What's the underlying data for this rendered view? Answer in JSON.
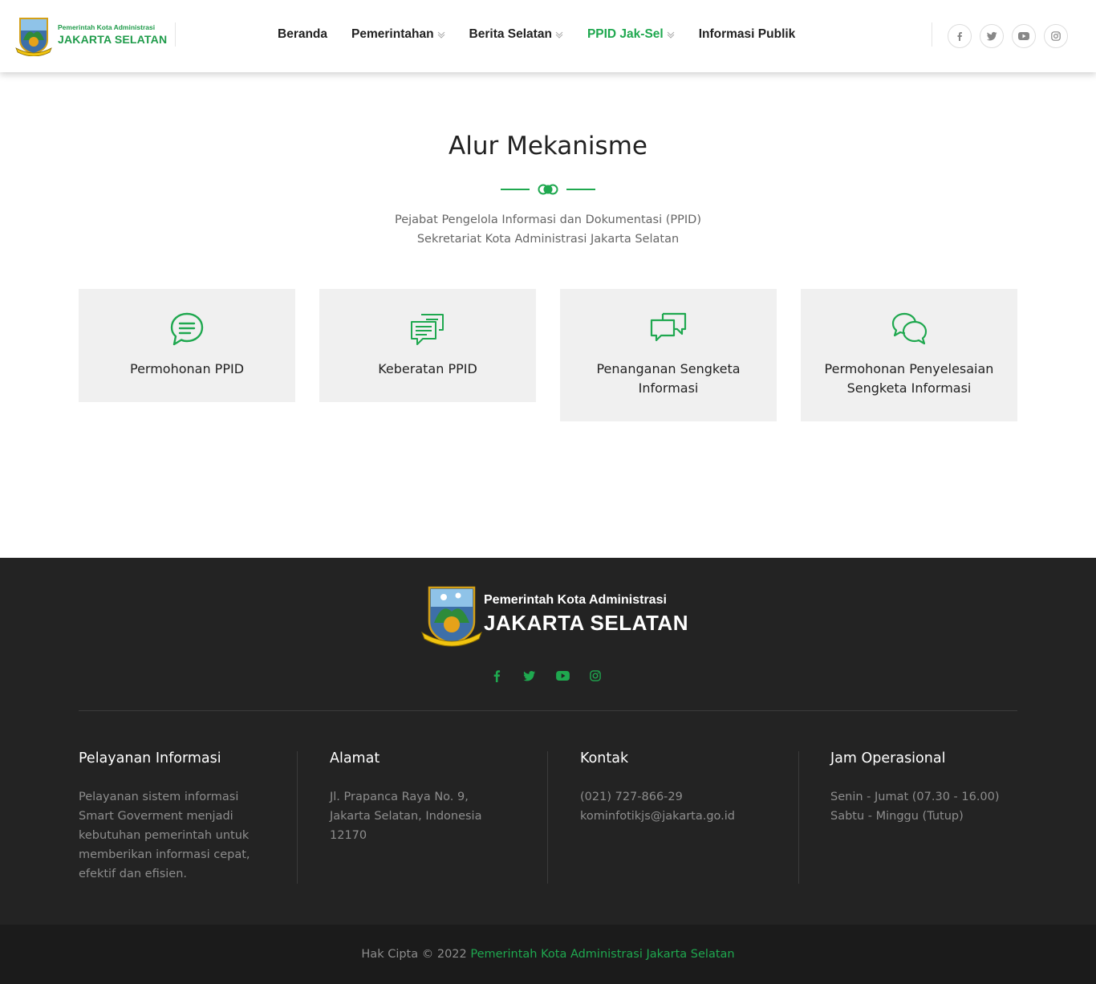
{
  "header": {
    "logo": {
      "line1": "Pemerintah Kota Administrasi",
      "line2": "JAKARTA SELATAN"
    },
    "nav": [
      {
        "label": "Beranda",
        "dropdown": false,
        "active": false
      },
      {
        "label": "Pemerintahan",
        "dropdown": true,
        "active": false
      },
      {
        "label": "Berita Selatan",
        "dropdown": true,
        "active": false
      },
      {
        "label": "PPID Jak-Sel",
        "dropdown": true,
        "active": true
      },
      {
        "label": "Informasi Publik",
        "dropdown": false,
        "active": false
      }
    ],
    "social_icons": [
      "facebook-icon",
      "twitter-icon",
      "youtube-icon",
      "instagram-icon"
    ]
  },
  "main": {
    "title": "Alur Mekanisme",
    "subtitle_line1": "Pejabat Pengelola Informasi dan Dokumentasi (PPID)",
    "subtitle_line2": "Sekretariat Kota Administrasi Jakarta Selatan",
    "cards": [
      {
        "icon": "chat-bubble-icon",
        "label": "Permohonan PPID"
      },
      {
        "icon": "messages-icon",
        "label": "Keberatan PPID"
      },
      {
        "icon": "conversation-icon",
        "label": "Penanganan Sengketa Informasi"
      },
      {
        "icon": "discussion-icon",
        "label": "Permohonan Penyelesaian Sengketa Informasi"
      }
    ]
  },
  "footer": {
    "logo": {
      "line1": "Pemerintah Kota Administrasi",
      "line2": "JAKARTA SELATAN"
    },
    "social_icons": [
      "facebook-icon",
      "twitter-icon",
      "youtube-icon",
      "instagram-icon"
    ],
    "columns": [
      {
        "title": "Pelayanan Informasi",
        "lines": [
          "Pelayanan sistem informasi",
          "Smart Goverment menjadi",
          "kebutuhan pemerintah untuk",
          "memberikan informasi cepat,",
          "efektif dan efisien."
        ]
      },
      {
        "title": "Alamat",
        "lines": [
          "Jl. Prapanca Raya No. 9,",
          "Jakarta Selatan, Indonesia",
          "12170"
        ]
      },
      {
        "title": "Kontak",
        "lines": [
          "(021) 727-866-29",
          "kominfotikjs@jakarta.go.id"
        ]
      },
      {
        "title": "Jam Operasional",
        "lines": [
          "Senin - Jumat (07.30 - 16.00)",
          "Sabtu - Minggu (Tutup)"
        ]
      }
    ],
    "copyright_prefix": "Hak Cipta © 2022",
    "copyright_link": "Pemerintah Kota Administrasi Jakarta Selatan"
  },
  "colors": {
    "accent": "#1fa84f",
    "footer_bg": "#232323",
    "copyright_bg": "#1b1b1b",
    "card_bg": "#f0f0f0"
  }
}
